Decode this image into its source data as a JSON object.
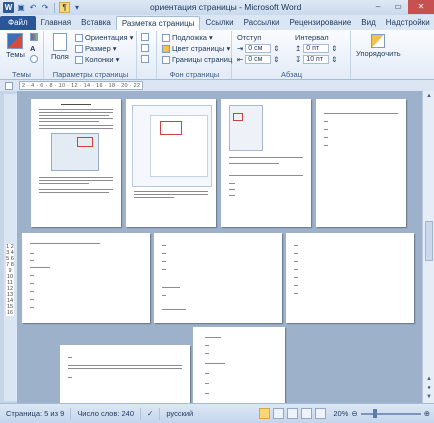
{
  "title_bar": {
    "title": "ориентация страницы - Microsoft Word",
    "app_icon_label": "W",
    "quick_access_icons": [
      "save-icon",
      "undo-icon",
      "redo-icon",
      "paragraph-marks-icon"
    ]
  },
  "tabs": [
    {
      "label": "Файл",
      "key": "file"
    },
    {
      "label": "Главная",
      "key": "home"
    },
    {
      "label": "Вставка",
      "key": "insert"
    },
    {
      "label": "Разметка страницы",
      "key": "page-layout"
    },
    {
      "label": "Ссылки",
      "key": "references"
    },
    {
      "label": "Рассылки",
      "key": "mailings"
    },
    {
      "label": "Рецензирование",
      "key": "review"
    },
    {
      "label": "Вид",
      "key": "view"
    },
    {
      "label": "Надстройки",
      "key": "addins"
    }
  ],
  "active_tab": "page-layout",
  "ribbon": {
    "themes": {
      "button_label": "Темы",
      "group_label": "Темы"
    },
    "page_setup": {
      "group_label": "Параметры страницы",
      "fields_label": "Поля",
      "orientation_label": "Ориентация",
      "size_label": "Размер",
      "columns_label": "Колонки"
    },
    "page_background": {
      "group_label": "Фон страницы",
      "watermark_label": "Подложка",
      "page_color_label": "Цвет страницы",
      "page_borders_label": "Границы страниц"
    },
    "paragraph": {
      "group_label": "Абзац",
      "indent_label": "Отступ",
      "spacing_label": "Интервал",
      "indent_left": "0 см",
      "indent_right": "0 см",
      "spacing_before": "0 пт",
      "spacing_after": "10 пт"
    },
    "arrange": {
      "button_label": "Упорядочить"
    }
  },
  "ruler": {
    "horizontal_numbers": "2 · 4 · 6 · 8 · 10 · 12 · 14 · 16 · 18 · 20 · 22 · 24",
    "vertical_numbers": "1 2 3 4 5 6 7 8 9 10 11 12 13 14 15 16"
  },
  "status_bar": {
    "page_info": "Страница: 5 из 9",
    "word_count": "Число слов: 240",
    "language": "русский",
    "zoom": "20%"
  },
  "colors": {
    "file_tab": "#2a5699",
    "close_button": "#c75050",
    "document_background": "#9eb1cb"
  }
}
